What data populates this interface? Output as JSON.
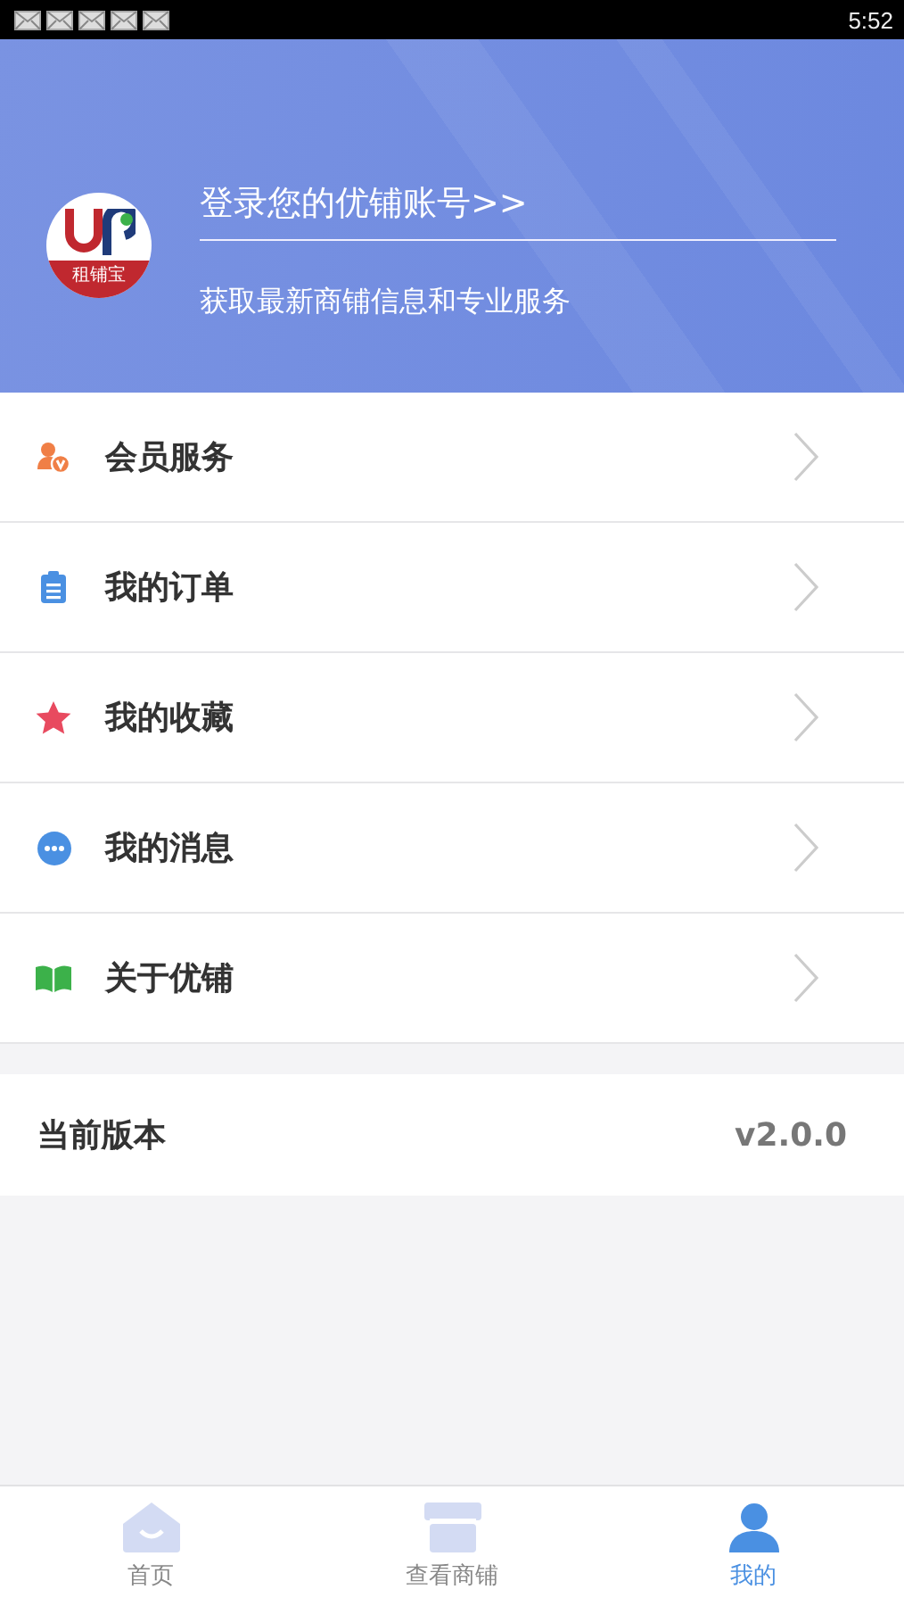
{
  "status_bar": {
    "notifications": [
      {
        "kind": "mail"
      },
      {
        "kind": "mail"
      },
      {
        "kind": "mail"
      },
      {
        "kind": "mail"
      },
      {
        "kind": "mail"
      }
    ],
    "time": "5:52"
  },
  "profile": {
    "login_prompt": "登录您的优铺账号>>",
    "subtitle": "获取最新商铺信息和专业服务",
    "logo_caption": "租铺宝"
  },
  "menu": [
    {
      "kind": "member",
      "label": "会员服务"
    },
    {
      "kind": "orders",
      "label": "我的订单"
    },
    {
      "kind": "favorites",
      "label": "我的收藏"
    },
    {
      "kind": "messages",
      "label": "我的消息"
    },
    {
      "kind": "about",
      "label": "关于优铺"
    }
  ],
  "version": {
    "label": "当前版本",
    "value": "v2.0.0"
  },
  "tab_bar": [
    {
      "kind": "home",
      "label": "首页",
      "selected": false
    },
    {
      "kind": "shops",
      "label": "查看商铺",
      "selected": false
    },
    {
      "kind": "me",
      "label": "我的",
      "selected": true
    }
  ]
}
